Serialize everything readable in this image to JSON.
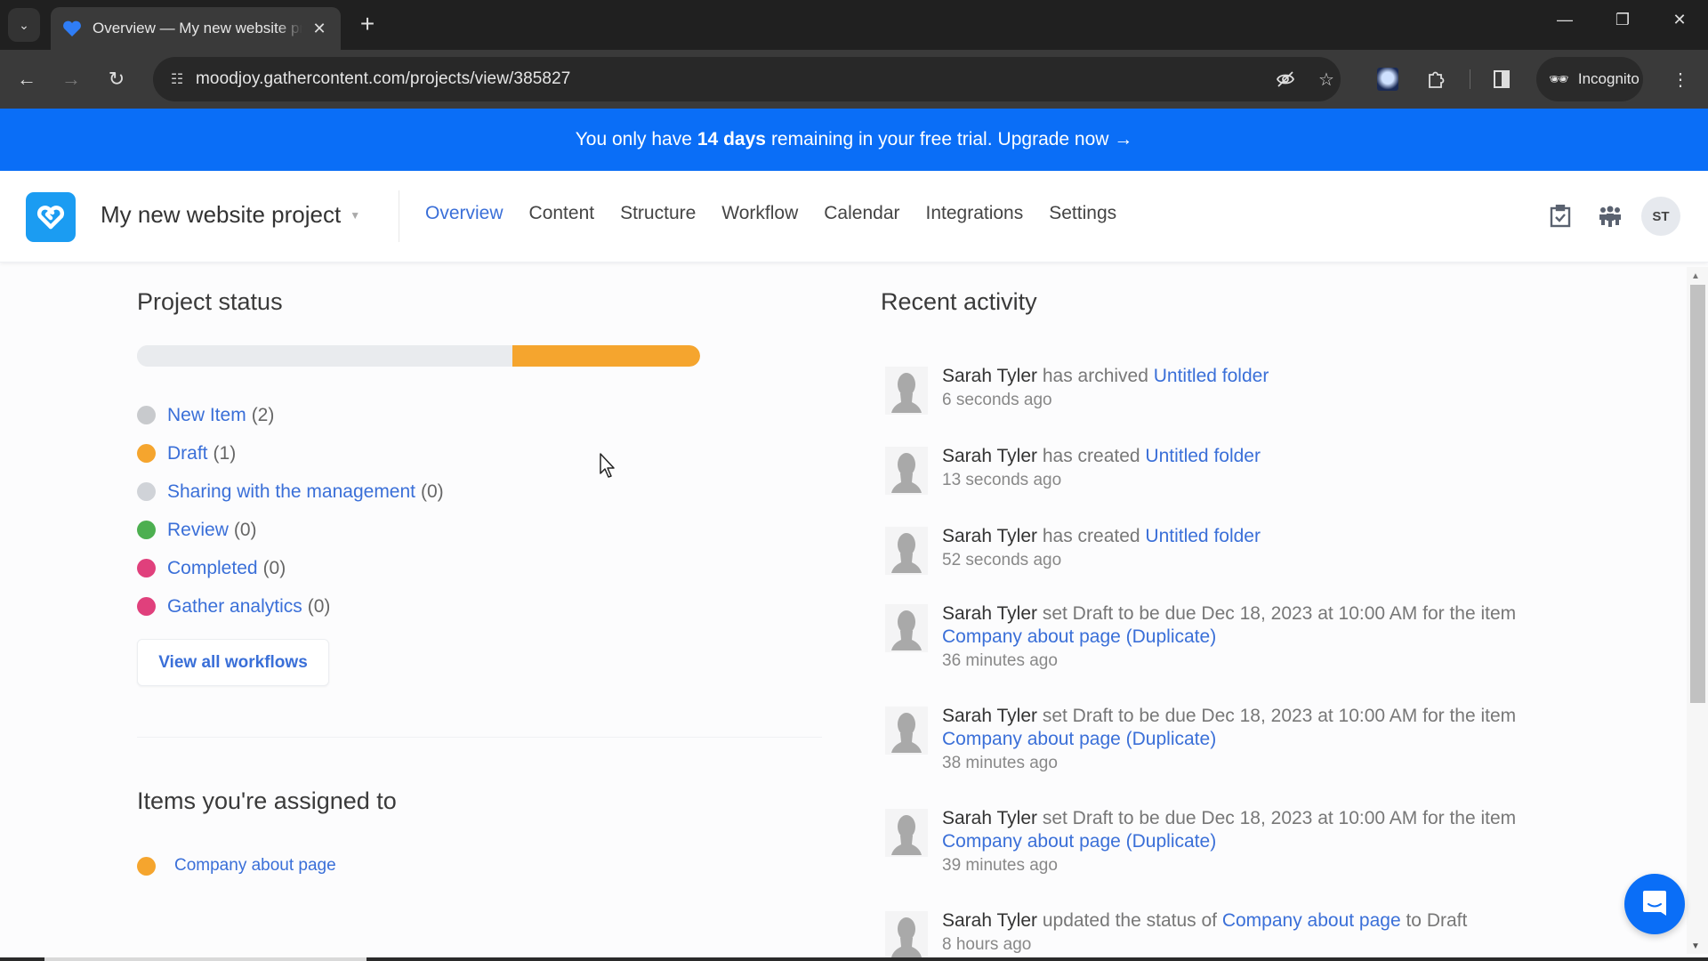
{
  "browser": {
    "tab_title": "Overview — My new website project",
    "url": "moodjoy.gathercontent.com/projects/view/385827",
    "incognito_label": "Incognito",
    "icons": {
      "tab_list": "chevron-down-icon",
      "new_tab": "plus-icon",
      "back": "arrow-left-icon",
      "forward": "arrow-right-icon",
      "reload": "reload-icon",
      "site_info": "tune-icon",
      "eye_off": "eye-off-icon",
      "bookmark": "star-icon",
      "extensions": "puzzle-icon",
      "side_panel": "side-panel-icon",
      "menu": "kebab-icon"
    }
  },
  "banner": {
    "prefix": "You only have",
    "highlight": "14 days",
    "suffix": "remaining in your free trial.",
    "cta": "Upgrade now →",
    "color": "#0a6ef7"
  },
  "header": {
    "project_name": "My new website project",
    "nav": [
      {
        "label": "Overview",
        "active": true
      },
      {
        "label": "Content",
        "active": false
      },
      {
        "label": "Structure",
        "active": false
      },
      {
        "label": "Workflow",
        "active": false
      },
      {
        "label": "Calendar",
        "active": false
      },
      {
        "label": "Integrations",
        "active": false
      },
      {
        "label": "Settings",
        "active": false
      }
    ],
    "avatar_initials": "ST",
    "accent_color": "#3a6fd8"
  },
  "project_status": {
    "title": "Project status",
    "progress": [
      {
        "status": "New Item",
        "fraction": 0.667,
        "color": "#e9ebee"
      },
      {
        "status": "Draft",
        "fraction": 0.333,
        "color": "#f5a52e"
      }
    ],
    "statuses": [
      {
        "label": "New Item",
        "count": "(2)",
        "color": "#c8cacd"
      },
      {
        "label": "Draft",
        "count": "(1)",
        "color": "#f5a52e"
      },
      {
        "label": "Sharing with the management",
        "count": "(0)",
        "color": "#d0d3d8"
      },
      {
        "label": "Review",
        "count": "(0)",
        "color": "#4caf50"
      },
      {
        "label": "Completed",
        "count": "(0)",
        "color": "#e0407c"
      },
      {
        "label": "Gather analytics",
        "count": "(0)",
        "color": "#e0407c"
      }
    ],
    "view_all_label": "View all workflows"
  },
  "assigned": {
    "title": "Items you're assigned to",
    "items": [
      {
        "label": "Company about page",
        "color": "#f5a52e"
      }
    ]
  },
  "recent_activity": {
    "title": "Recent activity",
    "entries": [
      {
        "user": "Sarah Tyler",
        "action": " has archived ",
        "link": "Untitled folder",
        "after": "",
        "time": "6 seconds ago"
      },
      {
        "user": "Sarah Tyler",
        "action": " has created ",
        "link": "Untitled folder",
        "after": "",
        "time": "13 seconds ago"
      },
      {
        "user": "Sarah Tyler",
        "action": " has created ",
        "link": "Untitled folder",
        "after": "",
        "time": "52 seconds ago"
      },
      {
        "user": "Sarah Tyler",
        "action": " set Draft to be due Dec 18, 2023 at 10:00 AM for the item ",
        "link": "Company about page (Duplicate)",
        "after": "",
        "time": "36 minutes ago"
      },
      {
        "user": "Sarah Tyler",
        "action": " set Draft to be due Dec 18, 2023 at 10:00 AM for the item ",
        "link": "Company about page (Duplicate)",
        "after": "",
        "time": "38 minutes ago"
      },
      {
        "user": "Sarah Tyler",
        "action": " set Draft to be due Dec 18, 2023 at 10:00 AM for the item ",
        "link": "Company about page (Duplicate)",
        "after": "",
        "time": "39 minutes ago"
      },
      {
        "user": "Sarah Tyler",
        "action": " updated the status of ",
        "link": "Company about page",
        "after": " to Draft",
        "time": "8 hours ago"
      }
    ]
  }
}
